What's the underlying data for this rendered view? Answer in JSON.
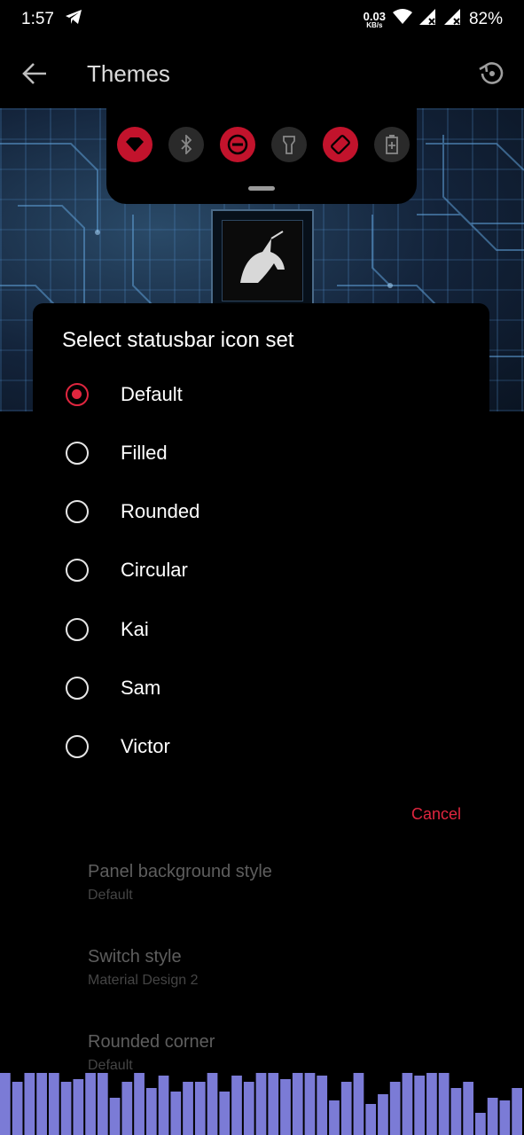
{
  "statusbar": {
    "time": "1:57",
    "net_speed_value": "0.03",
    "net_speed_unit": "KB/s",
    "battery": "82%",
    "icons": [
      "telegram-icon",
      "wifi-icon",
      "signal-icon",
      "signal-icon"
    ]
  },
  "appbar": {
    "title": "Themes",
    "back_icon": "arrow-left-icon",
    "reset_icon": "restore-icon"
  },
  "preview": {
    "quick_tiles": [
      {
        "icon": "wifi-icon",
        "state": "on"
      },
      {
        "icon": "bluetooth-icon",
        "state": "off"
      },
      {
        "icon": "dnd-icon",
        "state": "on"
      },
      {
        "icon": "flashlight-icon",
        "state": "off"
      },
      {
        "icon": "autorotate-icon",
        "state": "on"
      },
      {
        "icon": "battery-saver-icon",
        "state": "off"
      }
    ],
    "accent_color": "#c2132c"
  },
  "dialog": {
    "title": "Select statusbar icon set",
    "options": [
      {
        "label": "Default",
        "selected": true
      },
      {
        "label": "Filled",
        "selected": false
      },
      {
        "label": "Rounded",
        "selected": false
      },
      {
        "label": "Circular",
        "selected": false
      },
      {
        "label": "Kai",
        "selected": false
      },
      {
        "label": "Sam",
        "selected": false
      },
      {
        "label": "Victor",
        "selected": false
      }
    ],
    "cancel_label": "Cancel",
    "accent_color": "#e0263f"
  },
  "settings": [
    {
      "title": "Panel background style",
      "value": "Default"
    },
    {
      "title": "Switch style",
      "value": "Material Design 2"
    },
    {
      "title": "Rounded corner",
      "value": "Default"
    }
  ],
  "visualizer": {
    "color": "#7b7bd6",
    "levels": [
      1,
      0.85,
      1,
      1,
      1,
      0.85,
      0.9,
      1,
      1,
      0.6,
      0.85,
      1,
      0.75,
      0.95,
      0.7,
      0.85,
      0.85,
      1,
      0.7,
      0.95,
      0.85,
      1,
      1,
      0.9,
      1,
      1,
      0.95,
      0.55,
      0.85,
      1,
      0.5,
      0.65,
      0.85,
      1,
      0.95,
      1,
      1,
      0.75,
      0.85,
      0.35,
      0.6,
      0.55,
      0.75
    ]
  }
}
